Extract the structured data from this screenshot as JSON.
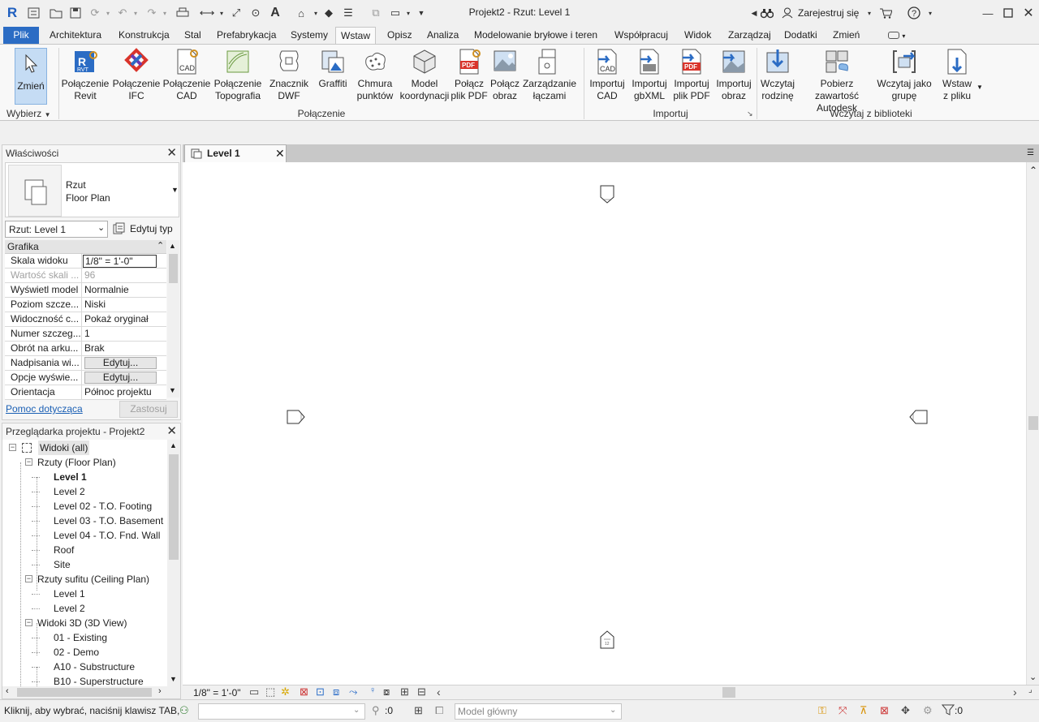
{
  "app": {
    "title": "Projekt2 - Rzut: Level 1",
    "sign_in": "Zarejestruj się",
    "logo": "R"
  },
  "tabs": [
    "Plik",
    "Architektura",
    "Konstrukcja",
    "Stal",
    "Prefabrykacja",
    "Systemy",
    "Wstaw",
    "Opisz",
    "Analiza",
    "Modelowanie bryłowe i teren",
    "Współpracuj",
    "Widok",
    "Zarządzaj",
    "Dodatki",
    "Zmień"
  ],
  "active_tab": "Wstaw",
  "ribbon": {
    "modify": "Zmień",
    "select_panel": "Wybierz",
    "link_buttons": [
      {
        "label": "Połączenie\nRevit",
        "icon": "revit-link-icon"
      },
      {
        "label": "Połączenie\nIFC",
        "icon": "ifc-link-icon"
      },
      {
        "label": "Połączenie\nCAD",
        "icon": "cad-link-icon"
      },
      {
        "label": "Połączenie\nTopografia",
        "icon": "topography-link-icon"
      },
      {
        "label": "Znacznik\nDWF",
        "icon": "dwf-markup-icon"
      },
      {
        "label": "Graffiti",
        "icon": "decal-icon"
      },
      {
        "label": "Chmura\npunktów",
        "icon": "point-cloud-icon"
      },
      {
        "label": "Model\nkoordynacji",
        "icon": "coordination-model-icon"
      },
      {
        "label": "Połącz\nplik PDF",
        "icon": "pdf-link-icon"
      },
      {
        "label": "Połącz\nobraz",
        "icon": "image-link-icon"
      },
      {
        "label": "Zarządzanie\nłączami",
        "icon": "manage-links-icon"
      }
    ],
    "link_panel": "Połączenie",
    "import_buttons": [
      {
        "label": "Importuj\nCAD",
        "icon": "import-cad-icon"
      },
      {
        "label": "Importuj\ngbXML",
        "icon": "import-gbxml-icon"
      },
      {
        "label": "Importuj\nplik PDF",
        "icon": "import-pdf-icon"
      },
      {
        "label": "Importuj\nobraz",
        "icon": "import-image-icon"
      }
    ],
    "import_panel": "Importuj",
    "library_buttons": [
      {
        "label": "Wczytaj\nrodzinę",
        "icon": "load-family-icon"
      },
      {
        "label": "Pobierz zawartość\nAutodesk",
        "icon": "autodesk-content-icon"
      },
      {
        "label": "Wczytaj jako\ngrupę",
        "icon": "load-as-group-icon"
      },
      {
        "label": "Wstaw\nz pliku",
        "icon": "insert-from-file-icon"
      }
    ],
    "library_panel": "Wczytaj z biblioteki"
  },
  "properties": {
    "title": "Właściwości",
    "type_name": "Rzut",
    "type_sub": "Floor Plan",
    "instance_select": "Rzut: Level 1",
    "edit_type": "Edytuj typ",
    "group": "Grafika",
    "rows": [
      {
        "k": "Skala widoku",
        "v": "1/8\" = 1'-0\"",
        "kind": "input"
      },
      {
        "k": "Wartość skali ...",
        "v": "96",
        "kind": "dim"
      },
      {
        "k": "Wyświetl model",
        "v": "Normalnie",
        "kind": "text"
      },
      {
        "k": "Poziom szcze...",
        "v": "Niski",
        "kind": "text"
      },
      {
        "k": "Widoczność c...",
        "v": "Pokaż oryginał",
        "kind": "text"
      },
      {
        "k": "Numer szczeg...",
        "v": "1",
        "kind": "text"
      },
      {
        "k": "Obrót na arku...",
        "v": "Brak",
        "kind": "text"
      },
      {
        "k": "Nadpisania wi...",
        "v": "Edytuj...",
        "kind": "button"
      },
      {
        "k": "Opcje wyświe...",
        "v": "Edytuj...",
        "kind": "button"
      },
      {
        "k": "Orientacja",
        "v": "Północ projektu",
        "kind": "text"
      }
    ],
    "help_link": "Pomoc dotycząca",
    "apply": "Zastosuj"
  },
  "browser": {
    "title": "Przeglądarka projektu - Projekt2",
    "nodes": [
      {
        "label": "Widoki (all)",
        "level": 0,
        "toggle": "−",
        "selected": true
      },
      {
        "label": "Rzuty (Floor Plan)",
        "level": 1,
        "toggle": "−"
      },
      {
        "label": "Level 1",
        "level": 2,
        "bold": true
      },
      {
        "label": "Level 2",
        "level": 2
      },
      {
        "label": "Level 02 - T.O. Footing",
        "level": 2
      },
      {
        "label": "Level 03 - T.O. Basement",
        "level": 2
      },
      {
        "label": "Level 04 - T.O. Fnd. Wall",
        "level": 2
      },
      {
        "label": "Roof",
        "level": 2
      },
      {
        "label": "Site",
        "level": 2
      },
      {
        "label": "Rzuty sufitu (Ceiling Plan)",
        "level": 1,
        "toggle": "−"
      },
      {
        "label": "Level 1",
        "level": 2
      },
      {
        "label": "Level 2",
        "level": 2
      },
      {
        "label": "Widoki 3D (3D View)",
        "level": 1,
        "toggle": "−"
      },
      {
        "label": "01 - Existing",
        "level": 2
      },
      {
        "label": "02 - Demo",
        "level": 2
      },
      {
        "label": "A10 - Substructure",
        "level": 2
      },
      {
        "label": "B10 - Superstructure",
        "level": 2
      }
    ]
  },
  "view": {
    "tab_label": "Level 1",
    "scale": "1/8\" = 1'-0\""
  },
  "status": {
    "message": "Kliknij, aby wybrać, naciśnij klawisz TAB,",
    "selection_count": ":0",
    "model": "Model główny",
    "filter_count": ":0"
  },
  "colors": {
    "accent": "#2b6cc4",
    "selected_bg": "#c5dcf4"
  }
}
